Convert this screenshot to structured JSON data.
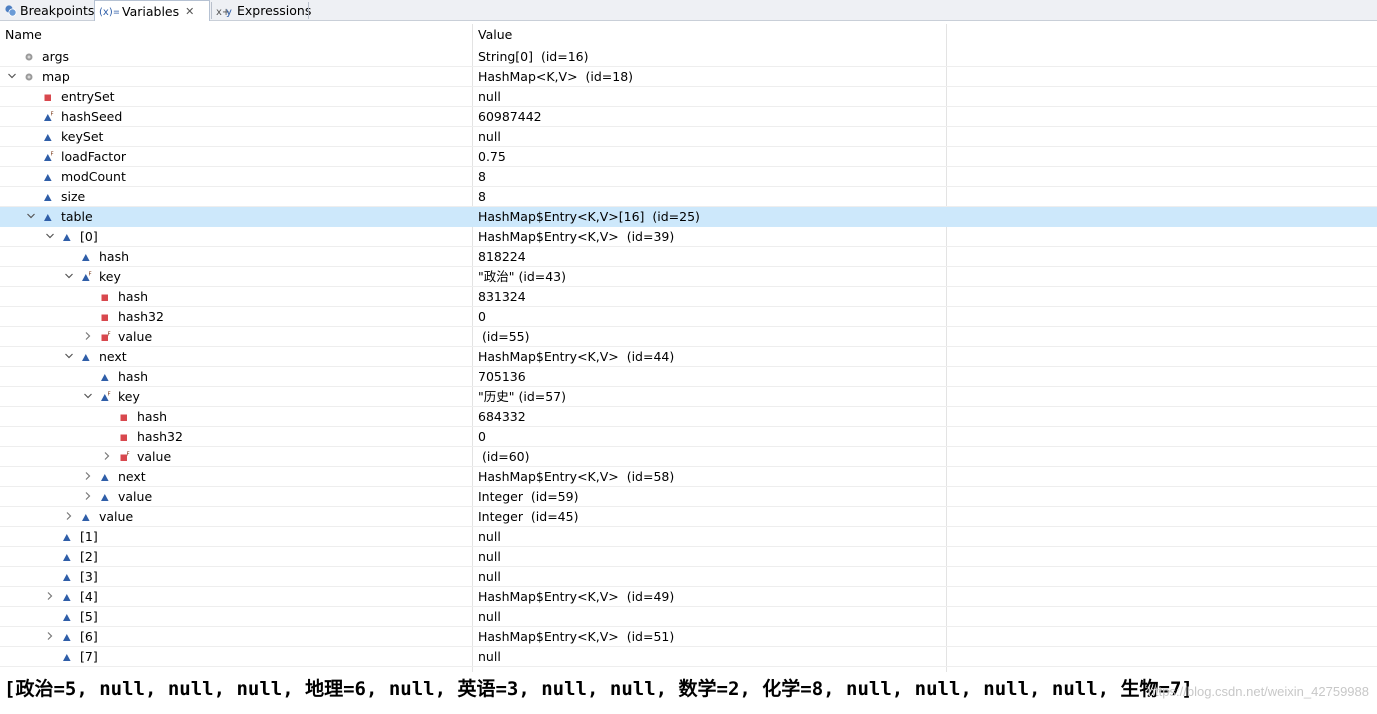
{
  "tabs": [
    {
      "label": "Breakpoints",
      "icon": "breakpoints-icon",
      "active": false
    },
    {
      "label": "Variables",
      "icon": "variables-icon",
      "active": true
    },
    {
      "label": "Expressions",
      "icon": "expressions-icon",
      "active": false
    }
  ],
  "columns": {
    "name": "Name",
    "value": "Value"
  },
  "rows": [
    {
      "name": "args",
      "value": "String[0]  (id=16)",
      "depth": 0,
      "icon": "local-variable-icon",
      "expander": "none",
      "final": false
    },
    {
      "name": "map",
      "value": "HashMap<K,V>  (id=18)",
      "depth": 0,
      "icon": "local-variable-icon",
      "expander": "expanded",
      "final": false
    },
    {
      "name": "entrySet",
      "value": "null",
      "depth": 1,
      "icon": "private-field-icon",
      "expander": "none",
      "final": false
    },
    {
      "name": "hashSeed",
      "value": "60987442",
      "depth": 1,
      "icon": "package-field-icon",
      "expander": "none",
      "final": true
    },
    {
      "name": "keySet",
      "value": "null",
      "depth": 1,
      "icon": "package-field-icon",
      "expander": "none",
      "final": false
    },
    {
      "name": "loadFactor",
      "value": "0.75",
      "depth": 1,
      "icon": "package-field-icon",
      "expander": "none",
      "final": true
    },
    {
      "name": "modCount",
      "value": "8",
      "depth": 1,
      "icon": "package-field-icon",
      "expander": "none",
      "final": false
    },
    {
      "name": "size",
      "value": "8",
      "depth": 1,
      "icon": "package-field-icon",
      "expander": "none",
      "final": false
    },
    {
      "name": "table",
      "value": "HashMap$Entry<K,V>[16]  (id=25)",
      "depth": 1,
      "icon": "package-field-icon",
      "expander": "expanded",
      "final": false,
      "selected": true
    },
    {
      "name": "[0]",
      "value": "HashMap$Entry<K,V>  (id=39)",
      "depth": 2,
      "icon": "package-field-icon",
      "expander": "expanded",
      "final": false
    },
    {
      "name": "hash",
      "value": "818224",
      "depth": 3,
      "icon": "package-field-icon",
      "expander": "none",
      "final": false
    },
    {
      "name": "key",
      "value": "\"政治\" (id=43)",
      "depth": 3,
      "icon": "package-field-icon",
      "expander": "expanded",
      "final": true
    },
    {
      "name": "hash",
      "value": "831324",
      "depth": 4,
      "icon": "private-field-icon",
      "expander": "none",
      "final": false
    },
    {
      "name": "hash32",
      "value": "0",
      "depth": 4,
      "icon": "private-field-icon",
      "expander": "none",
      "final": false
    },
    {
      "name": "value",
      "value": " (id=55)",
      "depth": 4,
      "icon": "private-field-icon",
      "expander": "collapsed",
      "final": true
    },
    {
      "name": "next",
      "value": "HashMap$Entry<K,V>  (id=44)",
      "depth": 3,
      "icon": "package-field-icon",
      "expander": "expanded",
      "final": false
    },
    {
      "name": "hash",
      "value": "705136",
      "depth": 4,
      "icon": "package-field-icon",
      "expander": "none",
      "final": false
    },
    {
      "name": "key",
      "value": "\"历史\" (id=57)",
      "depth": 4,
      "icon": "package-field-icon",
      "expander": "expanded",
      "final": true
    },
    {
      "name": "hash",
      "value": "684332",
      "depth": 5,
      "icon": "private-field-icon",
      "expander": "none",
      "final": false
    },
    {
      "name": "hash32",
      "value": "0",
      "depth": 5,
      "icon": "private-field-icon",
      "expander": "none",
      "final": false
    },
    {
      "name": "value",
      "value": " (id=60)",
      "depth": 5,
      "icon": "private-field-icon",
      "expander": "collapsed",
      "final": true
    },
    {
      "name": "next",
      "value": "HashMap$Entry<K,V>  (id=58)",
      "depth": 4,
      "icon": "package-field-icon",
      "expander": "collapsed",
      "final": false
    },
    {
      "name": "value",
      "value": "Integer  (id=59)",
      "depth": 4,
      "icon": "package-field-icon",
      "expander": "collapsed",
      "final": false
    },
    {
      "name": "value",
      "value": "Integer  (id=45)",
      "depth": 3,
      "icon": "package-field-icon",
      "expander": "collapsed",
      "final": false
    },
    {
      "name": "[1]",
      "value": "null",
      "depth": 2,
      "icon": "package-field-icon",
      "expander": "none",
      "final": false
    },
    {
      "name": "[2]",
      "value": "null",
      "depth": 2,
      "icon": "package-field-icon",
      "expander": "none",
      "final": false
    },
    {
      "name": "[3]",
      "value": "null",
      "depth": 2,
      "icon": "package-field-icon",
      "expander": "none",
      "final": false
    },
    {
      "name": "[4]",
      "value": "HashMap$Entry<K,V>  (id=49)",
      "depth": 2,
      "icon": "package-field-icon",
      "expander": "collapsed",
      "final": false
    },
    {
      "name": "[5]",
      "value": "null",
      "depth": 2,
      "icon": "package-field-icon",
      "expander": "none",
      "final": false
    },
    {
      "name": "[6]",
      "value": "HashMap$Entry<K,V>  (id=51)",
      "depth": 2,
      "icon": "package-field-icon",
      "expander": "collapsed",
      "final": false
    },
    {
      "name": "[7]",
      "value": "null",
      "depth": 2,
      "icon": "package-field-icon",
      "expander": "none",
      "final": false
    }
  ],
  "console_output": "[政治=5, null, null, null, 地理=6, null, 英语=3, null, null, 数学=2, 化学=8, null, null, null, null, 生物=7]",
  "watermark": "https://blog.csdn.net/weixin_42759988",
  "colors": {
    "selection": "#cde8fb",
    "package_field": "#2f5ea8",
    "private_field": "#d8484e",
    "local_variable": "#9a9a9a",
    "final_marker": "#7a3a1a"
  }
}
